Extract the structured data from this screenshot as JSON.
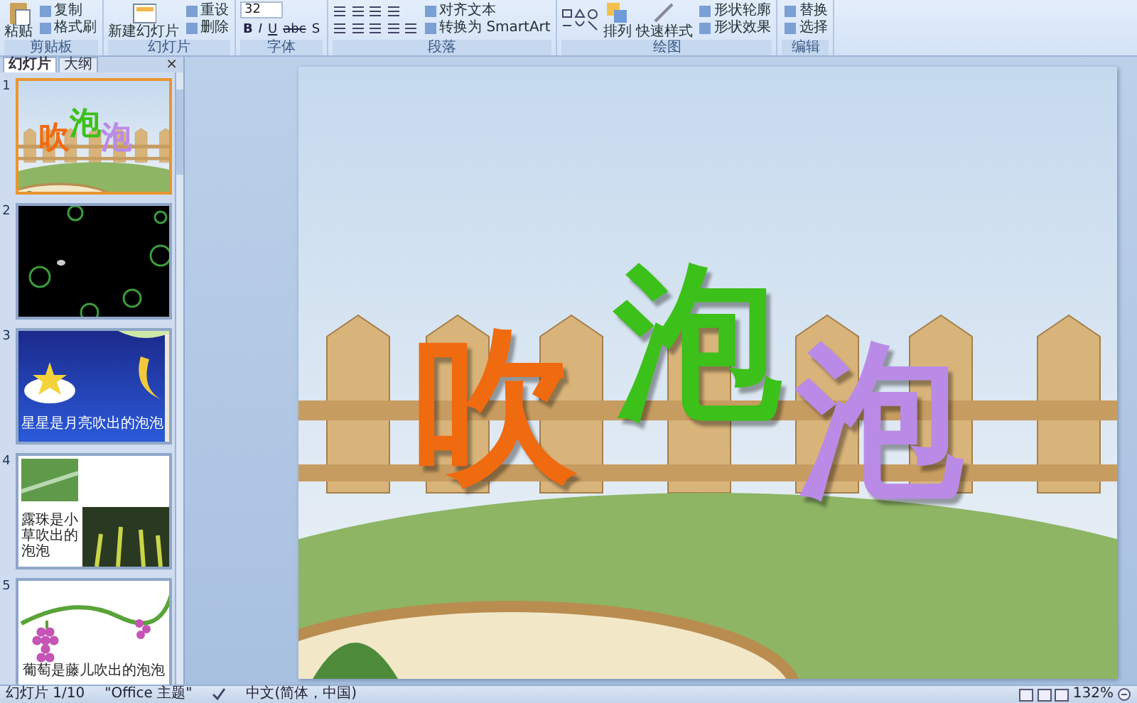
{
  "ribbon": {
    "groups": [
      {
        "kind": "clipboard",
        "label": "剪贴板",
        "large": "粘贴",
        "small": [
          "复制",
          "格式刷"
        ]
      },
      {
        "kind": "slides",
        "label": "幻灯片",
        "large": "新建幻灯片",
        "small": [
          "重设",
          "删除"
        ]
      },
      {
        "kind": "font",
        "label": "字体",
        "font_size": "32",
        "format_buttons": [
          "B",
          "I",
          "U",
          "abc",
          "S"
        ]
      },
      {
        "kind": "paragraph",
        "label": "段落",
        "small": [
          "对齐文本",
          "转换为 SmartArt"
        ]
      },
      {
        "kind": "drawing",
        "label": "绘图",
        "large": "排列",
        "large_2": "快速样式",
        "small": [
          "形状轮廓",
          "形状效果"
        ]
      },
      {
        "kind": "editing",
        "label": "编辑",
        "small": [
          "替换",
          "选择"
        ]
      }
    ]
  },
  "panel": {
    "tabs": [
      {
        "label": "幻灯片",
        "selected": true
      },
      {
        "label": "大纲",
        "selected": false
      }
    ],
    "close": "×"
  },
  "slides": [
    {
      "number": "1",
      "kind": "title",
      "selected": true,
      "title_chars": [
        {
          "text": "吹",
          "color": "#f06a10"
        },
        {
          "text": "泡",
          "color": "#3cc01a"
        },
        {
          "text": "泡",
          "color": "#b98be6"
        }
      ]
    },
    {
      "number": "2",
      "kind": "bubbles",
      "selected": false
    },
    {
      "number": "3",
      "kind": "night",
      "selected": false,
      "caption": "星星是月亮吹出的泡泡"
    },
    {
      "number": "4",
      "kind": "dew",
      "selected": false,
      "caption": "露珠是小草吹出的泡泡"
    },
    {
      "number": "5",
      "kind": "grapes",
      "selected": false,
      "caption": "葡萄是藤儿吹出的泡泡"
    }
  ],
  "slide": {
    "title_chars": [
      {
        "text": "吹",
        "color": "#f06a10"
      },
      {
        "text": "泡",
        "color": "#3cc01a"
      },
      {
        "text": "泡",
        "color": "#b98be6"
      }
    ]
  },
  "status_bar": {
    "slide": "幻灯片 1/10",
    "theme": "\"Office 主题\"",
    "language": "中文(简体，中国)",
    "zoom": "132%"
  }
}
